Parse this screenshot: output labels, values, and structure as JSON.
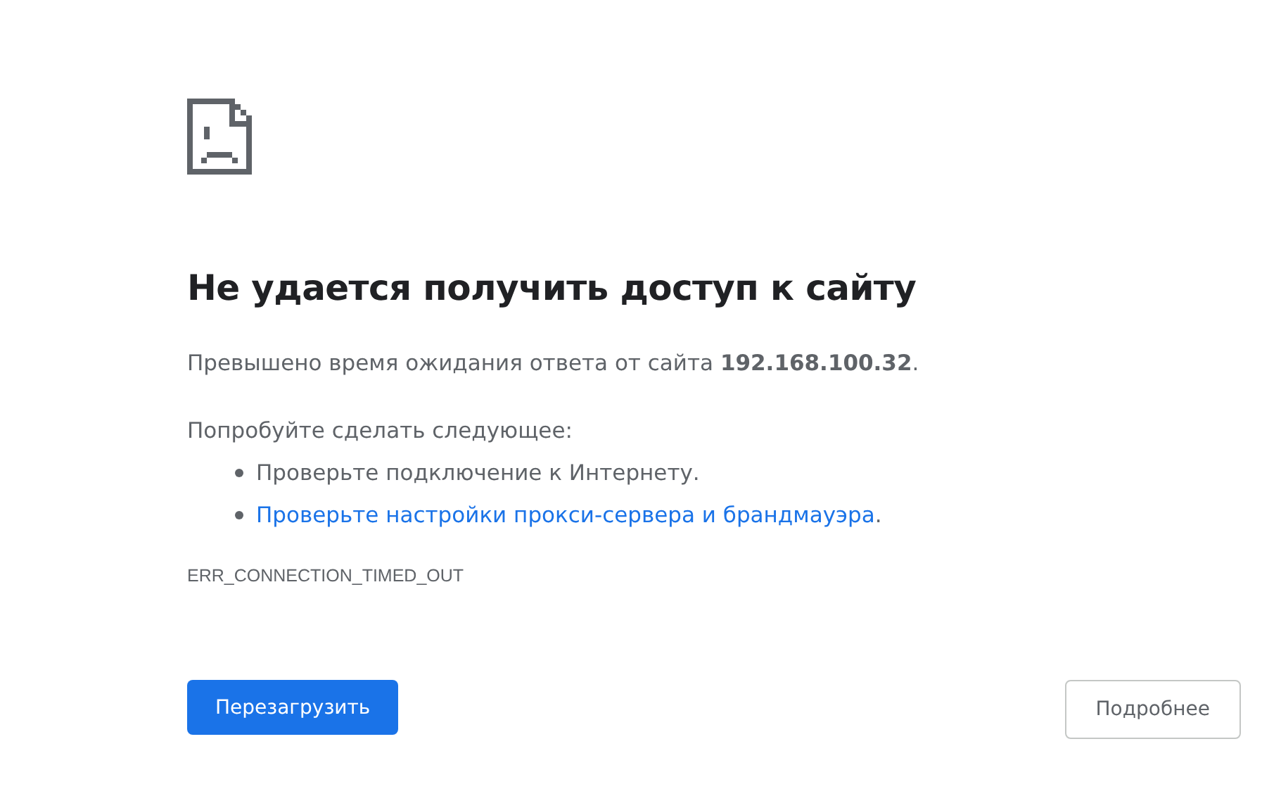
{
  "heading": "Не удается получить доступ к сайту",
  "summary": "Превышено время ожидания ответа от сайта **192.168.100.32**.",
  "suggestions_title": "Попробуйте сделать следующее:",
  "suggestions": [
    {
      "kind": "text",
      "text": "Проверьте подключение к Интернету."
    },
    {
      "kind": "link",
      "text": "Проверьте настройки прокси-сервера и брандмауэра",
      "suffix": "."
    }
  ],
  "error_code": "ERR_CONNECTION_TIMED_OUT",
  "buttons": {
    "reload": "Перезагрузить",
    "details": "Подробнее"
  }
}
